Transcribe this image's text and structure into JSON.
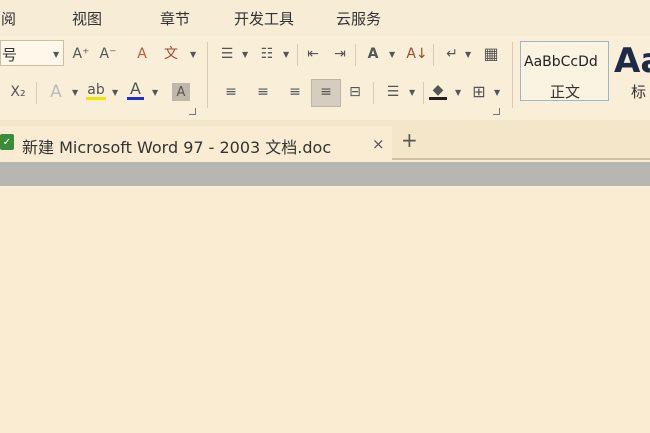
{
  "menu": [
    "审阅",
    "视图",
    "章节",
    "开发工具",
    "云服务"
  ],
  "ribbon": {
    "font_size_value": "号",
    "icons": {
      "grow_font": "A⁺",
      "shrink_font": "A⁻",
      "clear_format": "A",
      "phonetic": "文",
      "bullets": "☰",
      "numbering": "☷",
      "outdent": "⇤",
      "indent": "⇥",
      "char_scale": "A",
      "sort": "A↓",
      "show_marks": "↵",
      "table": "▦",
      "subscript": "X₂",
      "font_effect": "A",
      "highlight": "ab",
      "font_color": "A",
      "char_shade": "A",
      "align_left": "≡",
      "align_center": "≡",
      "align_right": "≡",
      "align_justify": "≡",
      "distributed": "⊟",
      "line_spacing": "☰",
      "shading": "◆",
      "borders": "⊞"
    },
    "styles": [
      {
        "sample": "AaBbCcDd",
        "name": "正文"
      },
      {
        "sample": "Aa",
        "name": "标"
      }
    ]
  },
  "tab": {
    "title": "新建 Microsoft Word 97 - 2003 文档.doc",
    "close": "×",
    "add": "+"
  }
}
